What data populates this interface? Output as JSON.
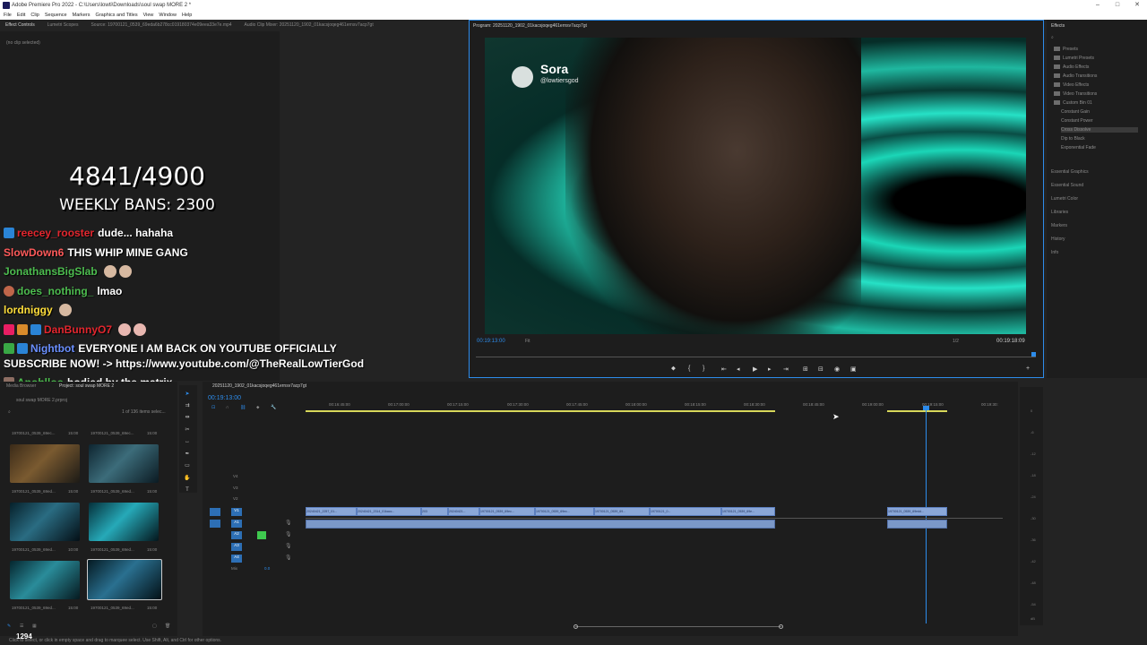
{
  "titlebar": {
    "title": "Adobe Premiere Pro 2022 - C:\\Users\\lowti\\Downloads\\soul swap MORE 2 *"
  },
  "menu": [
    "File",
    "Edit",
    "Clip",
    "Sequence",
    "Markers",
    "Graphics and Titles",
    "View",
    "Window",
    "Help"
  ],
  "source_panel": {
    "tabs": [
      "Effect Controls",
      "Lumetri Scopes",
      "Source: 19700121_0539_69eda6b278cc019180374e09eea33e7e.mp4",
      "Audio Clip Mixer: 20251120_1902_01kacsjoqeg461ernsv7acp7gt"
    ],
    "no_clip": "(no clip selected)"
  },
  "overlay": {
    "counter": "4841/4900",
    "weekly_bans": "WEEKLY BANS: 2300",
    "chat": [
      {
        "user": "reecey_rooster",
        "msg": "dude... hahaha",
        "color": "#e3262e"
      },
      {
        "user": "SlowDown6",
        "msg": "THIS WHIP MINE GANG",
        "color": "#ff5a5a"
      },
      {
        "user": "JonathansBigSlab",
        "msg": "",
        "color": "#4dbd4f"
      },
      {
        "user": "does_nothing_",
        "msg": "lmao",
        "color": "#4dbd4f"
      },
      {
        "user": "lordniggy",
        "msg": "",
        "color": "#ffde3a"
      },
      {
        "user": "DanBunnyO7",
        "msg": "",
        "color": "#e3262e"
      },
      {
        "user": "Nightbot",
        "msg": "EVERYONE I AM BACK ON YOUTUBE OFFICIALLY",
        "color": "#6a8fff"
      },
      {
        "user": "",
        "msg": "SUBSCRIBE NOW! -> https://www.youtube.com/@TheRealLowTierGod",
        "color": "#ffffff"
      },
      {
        "user": "Apohlloo",
        "msg": "bodied by the matrix",
        "color": "#4dbd4f"
      }
    ]
  },
  "program": {
    "tab": "Program: 20251120_1902_01kacsjoqeg461ernsv7acp7gt",
    "sora_name": "Sora",
    "sora_handle": "@lowtiersgod",
    "timecode": "00:19:13:00",
    "fit": "Fit",
    "quality": "1/2",
    "duration": "00:19:18:09"
  },
  "effects": {
    "title": "Effects",
    "tree": [
      "Presets",
      "Lumetri Presets",
      "Audio Effects",
      "Audio Transitions",
      "Video Effects",
      "Video Transitions",
      "Custom Bin 01",
      "Constant Gain",
      "Constant Power",
      "Cross Dissolve",
      "Dip to Black",
      "Exponential Fade"
    ],
    "panels": [
      "Essential Graphics",
      "Essential Sound",
      "Lumetri Color",
      "Libraries",
      "Markers",
      "History",
      "Info"
    ]
  },
  "project": {
    "tabs": [
      "Media Browser",
      "Project: soul swap MORE 2"
    ],
    "file": "soul swap MORE 2.prproj",
    "count": "1 of 136 items selec...",
    "items": [
      {
        "name": "19700121_0539_69ec...",
        "dur": "15:00"
      },
      {
        "name": "19700121_0539_69ec...",
        "dur": "15:00"
      },
      {
        "name": "19700121_0539_69ed...",
        "dur": "15:00"
      },
      {
        "name": "19700121_0539_69ed...",
        "dur": "15:00"
      },
      {
        "name": "19700121_0539_69ed...",
        "dur": "10:00"
      },
      {
        "name": "19700121_0539_69ed...",
        "dur": "15:00"
      },
      {
        "name": "19700121_0539_69ed...",
        "dur": "15:00"
      },
      {
        "name": "19700121_0539_69ed...",
        "dur": "15:00"
      }
    ],
    "view_count": "1294"
  },
  "timeline": {
    "tab": "20251120_1902_01kacsjoqeg461ernsv7acp7gt",
    "timecode": "00:19:13:00",
    "ruler": [
      "00:16:45:00",
      "00:17:00:00",
      "00:17:15:00",
      "00:17:30:00",
      "00:17:45:00",
      "00:18:00:00",
      "00:18:15:00",
      "00:18:30:00",
      "00:18:45:00",
      "00:19:00:00",
      "00:19:15:00",
      "00:19:30:"
    ],
    "tracks": [
      "V4",
      "V3",
      "V2",
      "V1",
      "A1",
      "A2",
      "A3",
      "A4",
      "Mix"
    ],
    "mix_value": "0.0",
    "clips": [
      "20240421_2257_01...",
      "20240421_2314_01kacc...",
      "203",
      "20240421...",
      "19700121_0539_69ec...",
      "19700121_0539_69ec...",
      "19700121_0539_69...",
      "19700121_0...",
      "19700121_0539_69e...",
      "19700121_0539_69edd..."
    ],
    "meter_labels": [
      "0",
      "-6",
      "-12",
      "-18",
      "-24",
      "-30",
      "-36",
      "-42",
      "-48",
      "-54",
      "dB"
    ]
  },
  "status": "Click to select, or click in empty space and drag to marquee select. Use Shift, Alt, and Ctrl for other options."
}
